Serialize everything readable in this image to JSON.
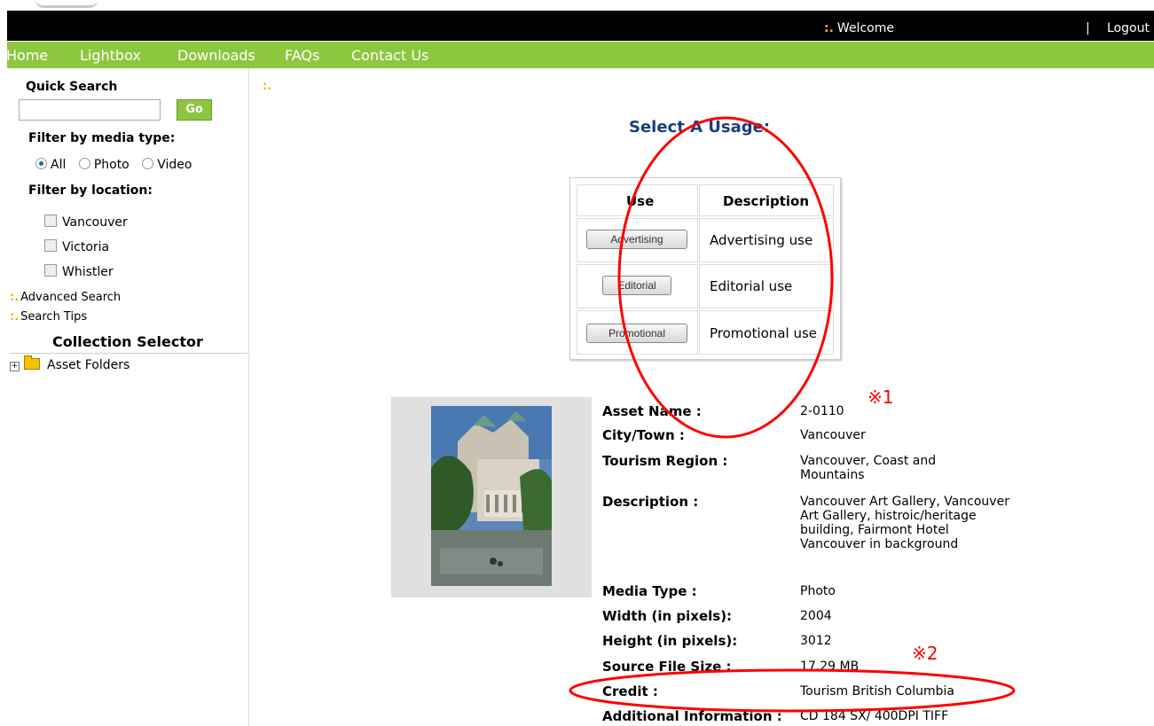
{
  "header": {
    "welcome": "Welcome",
    "separator": "|",
    "logout": "Logout"
  },
  "nav": {
    "items": [
      "Home",
      "Lightbox",
      "Downloads",
      "FAQs",
      "Contact Us"
    ]
  },
  "sidebar": {
    "quick_search_title": "Quick Search",
    "search_value": "",
    "go_label": "Go",
    "media_filter_title": "Filter by media type:",
    "media_options": [
      "All",
      "Photo",
      "Video"
    ],
    "media_selected": "All",
    "location_filter_title": "Filter by location:",
    "locations": [
      "Vancouver",
      "Victoria",
      "Whistler"
    ],
    "advanced_search": "Advanced Search",
    "search_tips": "Search Tips",
    "collection_title": "Collection Selector",
    "folders_label": "Asset Folders"
  },
  "usage": {
    "title": "Select A Usage:",
    "col_use": "Use",
    "col_description": "Description",
    "rows": [
      {
        "button": "Advertising",
        "description": "Advertising use"
      },
      {
        "button": "Editorial",
        "description": "Editorial use"
      },
      {
        "button": "Promotional",
        "description": "Promotional use"
      }
    ]
  },
  "asset": {
    "fields": [
      {
        "label": "Asset Name :",
        "value": "2-0110"
      },
      {
        "label": "City/Town :",
        "value": "Vancouver"
      },
      {
        "label": "Tourism Region :",
        "value": "Vancouver, Coast and Mountains"
      },
      {
        "label": "Description :",
        "value": "Vancouver Art Gallery, Vancouver Art Gallery, histroic/heritage building, Fairmont Hotel Vancouver in background"
      },
      {
        "label": "Media Type :",
        "value": "Photo"
      },
      {
        "label": "Width (in pixels):",
        "value": "2004"
      },
      {
        "label": "Height (in pixels):",
        "value": "3012"
      },
      {
        "label": "Source File Size :",
        "value": "17.29 MB"
      },
      {
        "label": "Credit :",
        "value": "Tourism British Columbia"
      },
      {
        "label": "Additional Information :",
        "value": "CD 184 SX/ 400DPI TIFF"
      }
    ]
  },
  "annotations": {
    "note1": "※1",
    "note2": "※2",
    "color": "#ff0000"
  },
  "colors": {
    "accent_green": "#8dc63f",
    "header_black": "#000000",
    "title_blue": "#1a3d7c",
    "bullet_orange": "#f0b400"
  }
}
